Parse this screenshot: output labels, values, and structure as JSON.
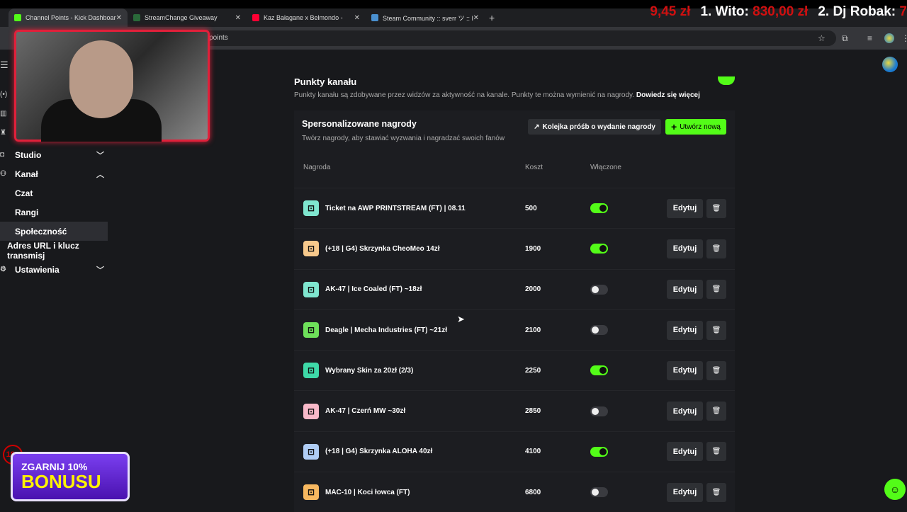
{
  "browser": {
    "tabs": [
      {
        "label": "Channel Points - Kick Dashboar",
        "favicon_color": "#53fc18",
        "active": true
      },
      {
        "label": "StreamChange Giveaway",
        "favicon_color": "#2a6a3a"
      },
      {
        "label": "Kaz Bałagane x Belmondo -",
        "favicon_color": "#ff0033"
      },
      {
        "label": "Steam Community :: sverr ツ :: I",
        "favicon_color": "#4a90d0"
      }
    ],
    "url_fragment": "el-points"
  },
  "ticker": {
    "prefix_amount": "9,45 zł",
    "first_name": "1. Wito:",
    "first_amount": "830,00 zł",
    "second_name": "2. Dj Robak:",
    "second_amount": "7"
  },
  "sidebar": {
    "items": [
      {
        "label": "Studio",
        "chevron": "down"
      },
      {
        "label": "Kanał",
        "chevron": "up"
      },
      {
        "label": "Czat"
      },
      {
        "label": "Rangi"
      },
      {
        "label": "Społeczność",
        "selected": true
      },
      {
        "label": "Adres URL i klucz transmisj"
      },
      {
        "label": "Ustawienia",
        "chevron": "down"
      }
    ]
  },
  "section": {
    "title": "Punkty kanału",
    "description": "Punkty kanału są zdobywane przez widzów za aktywność na kanale. Punkty te można wymienić na nagrody.",
    "learn_more": "Dowiedz się więcej",
    "enabled": true
  },
  "rewards_card": {
    "title": "Spersonalizowane nagrody",
    "subtitle": "Twórz nagrody, aby stawiać wyzwania i nagradzać swoich fanów",
    "queue_button": "Kolejka próśb o wydanie nagrody",
    "create_button": "Utwórz nową",
    "columns": [
      "Nagroda",
      "Koszt",
      "Włączone"
    ],
    "edit_label": "Edytuj",
    "rows": [
      {
        "name": "Ticket na AWP PRINTSTREAM (FT) | 08.11",
        "cost": "500",
        "enabled": true,
        "color": "#7fe6cf"
      },
      {
        "name": "(+18 | G4) Skrzynka CheoMeo 14zł",
        "cost": "1900",
        "enabled": true,
        "color": "#f7c98c"
      },
      {
        "name": "AK-47 | Ice Coaled (FT) ~18zł",
        "cost": "2000",
        "enabled": false,
        "color": "#7fe6cf"
      },
      {
        "name": "Deagle | Mecha Industries (FT) ~21zł",
        "cost": "2100",
        "enabled": false,
        "color": "#6ee05a"
      },
      {
        "name": "Wybrany Skin za 20zł (2/3)",
        "cost": "2250",
        "enabled": true,
        "color": "#3ed9a8"
      },
      {
        "name": "AK-47 | Czerń MW ~30zł",
        "cost": "2850",
        "enabled": false,
        "color": "#f7b8c8"
      },
      {
        "name": "(+18 | G4) Skrzynka ALOHA 40zł",
        "cost": "4100",
        "enabled": true,
        "color": "#b0cdf5"
      },
      {
        "name": "MAC-10 | Koci łowca (FT)",
        "cost": "6800",
        "enabled": false,
        "color": "#f7b860"
      }
    ]
  },
  "promo": {
    "line1": "ZGARNIJ 10%",
    "line2": "BONUSU",
    "age": "18+"
  }
}
